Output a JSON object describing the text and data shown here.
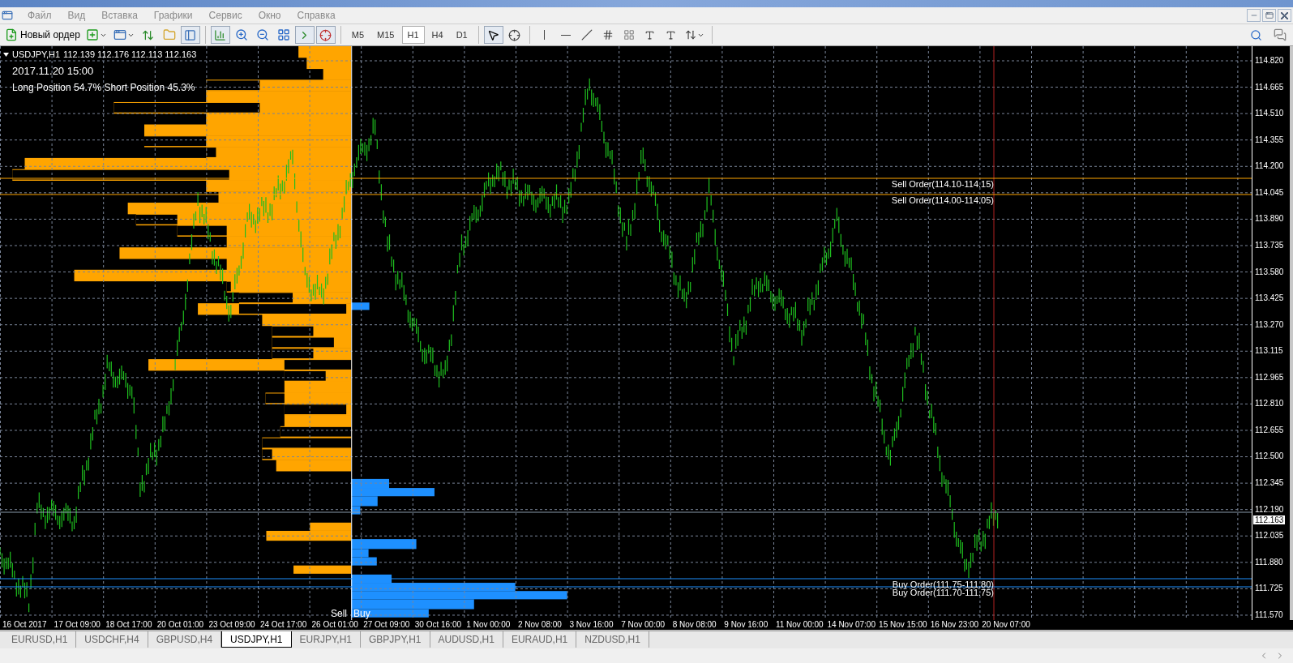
{
  "menu": [
    "Файл",
    "Вид",
    "Вставка",
    "Графики",
    "Сервис",
    "Окно",
    "Справка"
  ],
  "toolbar": {
    "new_order": "Новый ордер",
    "timeframes": [
      {
        "label": "M5",
        "selected": false
      },
      {
        "label": "M15",
        "selected": false
      },
      {
        "label": "H1",
        "selected": true
      },
      {
        "label": "H4",
        "selected": false
      },
      {
        "label": "D1",
        "selected": false
      }
    ]
  },
  "chart": {
    "symbol": "USDJPY,H1",
    "ohlc": "112.139 112.176 112.113 112.163",
    "datetime": "2017.11.20 15:00",
    "positions": "Long Position 54.7% Short Position 45.3%",
    "order_lines": [
      {
        "label": "Sell Order(114.10-114.15)",
        "kind": "sell"
      },
      {
        "label": "Sell Order(114.00-114.05)",
        "kind": "sell"
      },
      {
        "label": "Buy Order(111.75-111.80)",
        "kind": "buy"
      },
      {
        "label": "Buy Order(111.70-111.75)",
        "kind": "buy"
      }
    ],
    "histogram_labels": {
      "sell": "Sell",
      "buy": "Buy"
    },
    "current_price": "112.163",
    "price_axis": [
      "114.820",
      "114.665",
      "114.510",
      "114.355",
      "114.200",
      "114.045",
      "113.890",
      "113.735",
      "113.580",
      "113.425",
      "113.270",
      "113.115",
      "112.965",
      "112.810",
      "112.655",
      "112.500",
      "112.345",
      "112.190",
      "112.035",
      "111.880",
      "111.725",
      "111.570"
    ],
    "time_axis": [
      "16 Oct 2017",
      "17 Oct 09:00",
      "18 Oct 17:00",
      "20 Oct 01:00",
      "23 Oct 09:00",
      "24 Oct 17:00",
      "26 Oct 01:00",
      "27 Oct 09:00",
      "30 Oct 16:00",
      "1 Nov 00:00",
      "2 Nov 08:00",
      "3 Nov 16:00",
      "7 Nov 00:00",
      "8 Nov 08:00",
      "9 Nov 16:00",
      "11 Nov 00:00",
      "14 Nov 07:00",
      "15 Nov 15:00",
      "16 Nov 23:00",
      "20 Nov 07:00"
    ]
  },
  "tabs": [
    {
      "label": "EURUSD,H1",
      "selected": false
    },
    {
      "label": "USDCHF,H4",
      "selected": false
    },
    {
      "label": "GBPUSD,H4",
      "selected": false
    },
    {
      "label": "USDJPY,H1",
      "selected": true
    },
    {
      "label": "EURJPY,H1",
      "selected": false
    },
    {
      "label": "GBPJPY,H1",
      "selected": false
    },
    {
      "label": "AUDUSD,H1",
      "selected": false
    },
    {
      "label": "EURAUD,H1",
      "selected": false
    },
    {
      "label": "NZDUSD,H1",
      "selected": false
    }
  ]
}
